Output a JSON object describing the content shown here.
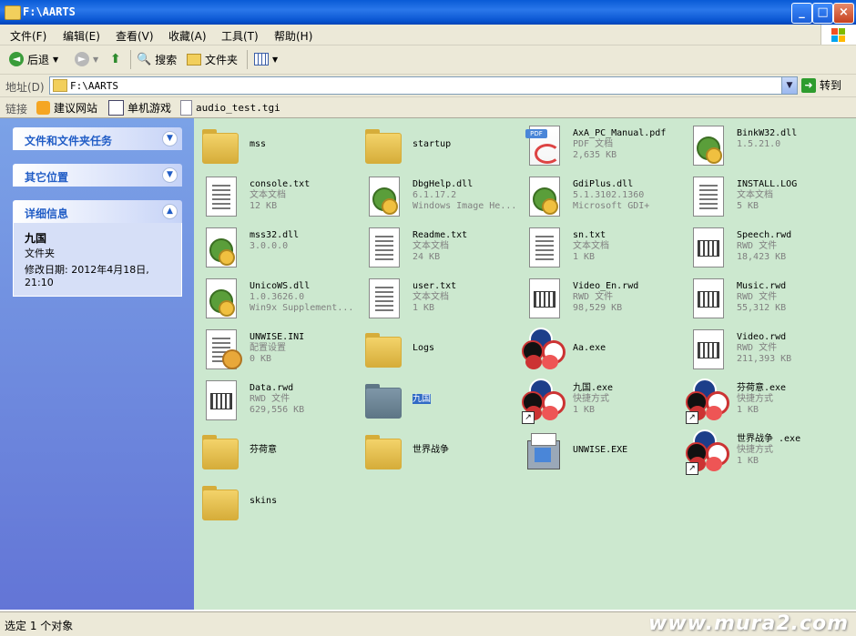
{
  "window": {
    "title": "F:\\AARTS"
  },
  "menu": [
    {
      "label": "文件(F)"
    },
    {
      "label": "编辑(E)"
    },
    {
      "label": "查看(V)"
    },
    {
      "label": "收藏(A)"
    },
    {
      "label": "工具(T)"
    },
    {
      "label": "帮助(H)"
    }
  ],
  "toolbar": {
    "back": "后退",
    "search": "搜索",
    "folders": "文件夹"
  },
  "address": {
    "label": "地址(D)",
    "value": "F:\\AARTS",
    "go": "转到"
  },
  "links": {
    "label": "链接",
    "items": [
      {
        "label": "建议网站"
      },
      {
        "label": "单机游戏"
      },
      {
        "label": "audio_test.tgi"
      }
    ]
  },
  "tasks": {
    "file_tasks": "文件和文件夹任务",
    "other_places": "其它位置",
    "details": "详细信息",
    "detail_name": "九国",
    "detail_type": "文件夹",
    "detail_modified": "修改日期: 2012年4月18日, 21:10"
  },
  "files": [
    {
      "name": "mss",
      "line2": "",
      "line3": "",
      "icon": "folder-icon"
    },
    {
      "name": "startup",
      "line2": "",
      "line3": "",
      "icon": "folder-icon"
    },
    {
      "name": "AxA_PC_Manual.pdf",
      "line2": "PDF 文档",
      "line3": "2,635 KB",
      "icon": "pdf-icon"
    },
    {
      "name": "BinkW32.dll",
      "line2": "1.5.21.0",
      "line3": "",
      "icon": "dll-icon"
    },
    {
      "name": "console.txt",
      "line2": "文本文档",
      "line3": "12 KB",
      "icon": "text-file-icon"
    },
    {
      "name": "DbgHelp.dll",
      "line2": "6.1.17.2",
      "line3": "Windows Image He...",
      "icon": "dll-icon"
    },
    {
      "name": "GdiPlus.dll",
      "line2": "5.1.3102.1360",
      "line3": "Microsoft GDI+",
      "icon": "dll-icon"
    },
    {
      "name": "INSTALL.LOG",
      "line2": "文本文档",
      "line3": "5 KB",
      "icon": "text-file-icon"
    },
    {
      "name": "mss32.dll",
      "line2": "3.0.0.0",
      "line3": "",
      "icon": "dll-icon"
    },
    {
      "name": "Readme.txt",
      "line2": "文本文档",
      "line3": "24 KB",
      "icon": "text-file-icon"
    },
    {
      "name": "sn.txt",
      "line2": "文本文档",
      "line3": "1 KB",
      "icon": "text-file-icon"
    },
    {
      "name": "Speech.rwd",
      "line2": "RWD 文件",
      "line3": "18,423 KB",
      "icon": "rwd-icon"
    },
    {
      "name": "UnicoWS.dll",
      "line2": "1.0.3626.0",
      "line3": "Win9x Supplement...",
      "icon": "dll-icon"
    },
    {
      "name": "user.txt",
      "line2": "文本文档",
      "line3": "1 KB",
      "icon": "text-file-icon"
    },
    {
      "name": "Video_En.rwd",
      "line2": "RWD 文件",
      "line3": "98,529 KB",
      "icon": "rwd-icon"
    },
    {
      "name": "Music.rwd",
      "line2": "RWD 文件",
      "line3": "55,312 KB",
      "icon": "rwd-icon"
    },
    {
      "name": "UNWISE.INI",
      "line2": "配置设置",
      "line3": "0 KB",
      "icon": "ini-icon"
    },
    {
      "name": "Logs",
      "line2": "",
      "line3": "",
      "icon": "folder-icon"
    },
    {
      "name": "Aa.exe",
      "line2": "",
      "line3": "",
      "icon": "game-exe-icon"
    },
    {
      "name": "Video.rwd",
      "line2": "RWD 文件",
      "line3": "211,393 KB",
      "icon": "rwd-icon"
    },
    {
      "name": "Data.rwd",
      "line2": "RWD 文件",
      "line3": "629,556 KB",
      "icon": "rwd-icon"
    },
    {
      "name": "九国",
      "line2": "",
      "line3": "",
      "icon": "folder-icon",
      "selected": true
    },
    {
      "name": "九国.exe",
      "line2": "快捷方式",
      "line3": "1 KB",
      "icon": "shortcut-icon"
    },
    {
      "name": "芬荷意.exe",
      "line2": "快捷方式",
      "line3": "1 KB",
      "icon": "shortcut-icon"
    },
    {
      "name": "芬荷意",
      "line2": "",
      "line3": "",
      "icon": "folder-icon"
    },
    {
      "name": "世界战争",
      "line2": "",
      "line3": "",
      "icon": "folder-icon"
    },
    {
      "name": "UNWISE.EXE",
      "line2": "",
      "line3": "",
      "icon": "uninstall-icon"
    },
    {
      "name": "世界战争 .exe",
      "line2": "快捷方式",
      "line3": "1 KB",
      "icon": "shortcut-icon"
    },
    {
      "name": "skins",
      "line2": "",
      "line3": "",
      "icon": "folder-icon"
    }
  ],
  "status": {
    "text": "选定 1 个对象",
    "watermark": "www.mura2.com"
  }
}
